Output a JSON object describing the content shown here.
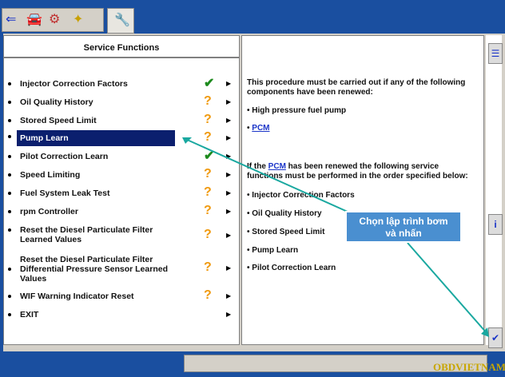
{
  "header": {
    "title": "Service Functions"
  },
  "items": [
    {
      "label": "Injector Correction Factors",
      "status": "check"
    },
    {
      "label": "Oil Quality History",
      "status": "question"
    },
    {
      "label": "Stored Speed Limit",
      "status": "question"
    },
    {
      "label": "Pump Learn",
      "status": "question",
      "selected": true
    },
    {
      "label": "Pilot Correction Learn",
      "status": "check"
    },
    {
      "label": "Speed Limiting",
      "status": "question"
    },
    {
      "label": "Fuel System Leak Test",
      "status": "question"
    },
    {
      "label": "rpm Controller",
      "status": "question"
    },
    {
      "label": "Reset the Diesel Particulate Filter\nLearned Values",
      "status": "question"
    },
    {
      "label": "Reset the Diesel Particulate Filter\nDifferential Pressure Sensor Learned\nValues",
      "status": "question"
    },
    {
      "label": "WIF Warning Indicator Reset",
      "status": "question"
    },
    {
      "label": "EXIT",
      "status": ""
    }
  ],
  "right": {
    "intro": "This procedure must be carried out if any of the following\ncomponents have been renewed:",
    "comp1": "• High pressure fuel pump",
    "comp2_prefix": "• ",
    "comp2_link": "PCM",
    "if_prefix": "If the ",
    "if_link": "PCM",
    "if_suffix": " has been renewed the following service\nfunctions must be performed in the order specified below:",
    "f1": "• Injector Correction Factors",
    "f2": "• Oil Quality History",
    "f3": "• Stored Speed Limit",
    "f4": "• Pump Learn",
    "f5": "• Pilot Correction Learn"
  },
  "callout": "Chọn lập trình bơm\nvà nhấn",
  "watermark": "OBDVIETNAM",
  "colors": {
    "selected": "#0b1f6e",
    "accent": "#1a4fa0",
    "question": "#f09a10",
    "check": "#1d8a1d"
  },
  "icons": {
    "toolbar": [
      "back-arrow-icon",
      "car-icon",
      "engine-icon",
      "plug-icon"
    ],
    "tab": "wrench-icon",
    "sidebar": [
      "list-icon",
      "info-icon",
      "checkmark-icon"
    ]
  }
}
